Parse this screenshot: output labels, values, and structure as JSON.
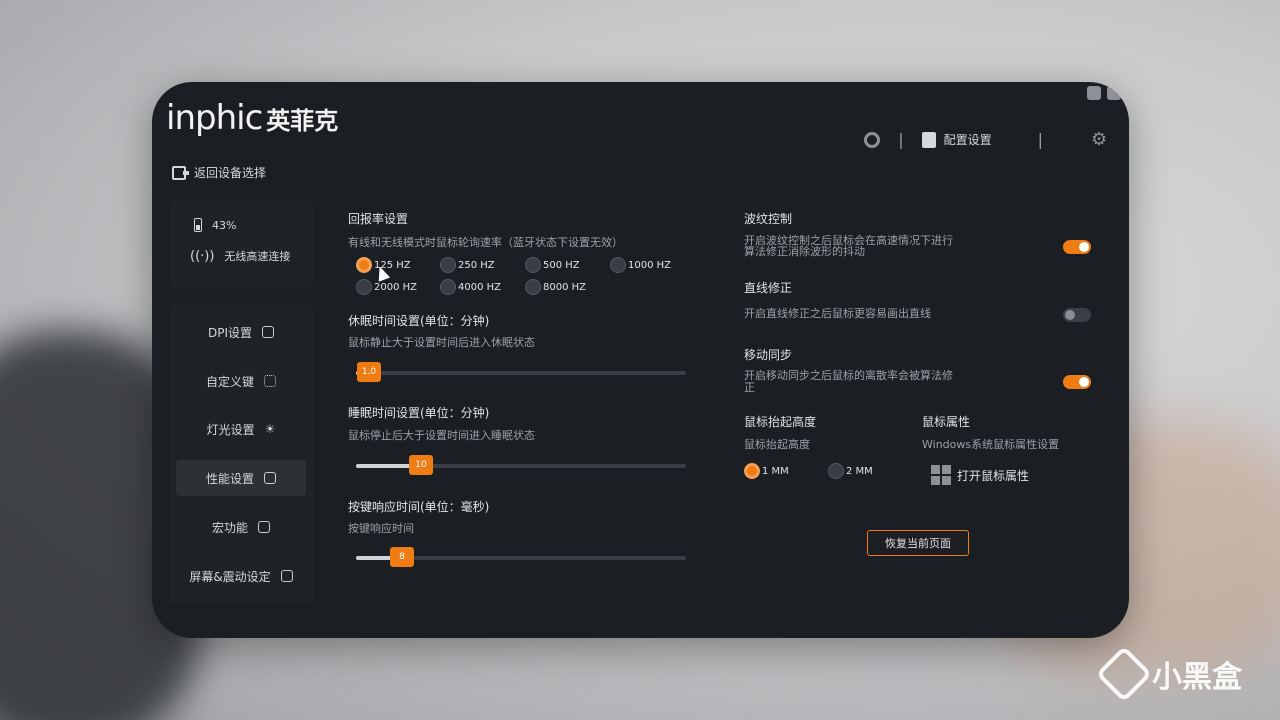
{
  "brand": {
    "name_en": "inphic",
    "name_cn": "英菲克"
  },
  "nav": {
    "back_label": "返回设备选择"
  },
  "topbar": {
    "config_label": "配置设置"
  },
  "device": {
    "battery": "43%",
    "connection": "无线高速连接"
  },
  "menu": {
    "items": [
      {
        "label": "DPI设置",
        "icon": "dpi-icon"
      },
      {
        "label": "自定义键",
        "icon": "keys-icon"
      },
      {
        "label": "灯光设置",
        "icon": "light-icon"
      },
      {
        "label": "性能设置",
        "icon": "performance-icon"
      },
      {
        "label": "宏功能",
        "icon": "macro-icon"
      },
      {
        "label": "屏幕&震动设定",
        "icon": "screen-icon"
      }
    ],
    "active_index": 3
  },
  "polling": {
    "title": "回报率设置",
    "desc": "有线和无线模式时鼠标轮询速率（蓝牙状态下设置无效）",
    "options": [
      "125 HZ",
      "250 HZ",
      "500 HZ",
      "1000 HZ",
      "2000 HZ",
      "4000 HZ",
      "8000 HZ"
    ],
    "selected": "125 HZ"
  },
  "idle": {
    "title": "休眠时间设置(单位：分钟)",
    "desc": "鼠标静止大于设置时间后进入休眠状态",
    "value": "1.0",
    "fraction": 0.02
  },
  "sleep": {
    "title": "睡眠时间设置(单位：分钟)",
    "desc": "鼠标停止后大于设置时间进入睡眠状态",
    "value": "10",
    "fraction": 0.18
  },
  "response": {
    "title": "按键响应时间(单位：毫秒)",
    "desc": "按键响应时间",
    "value": "8",
    "fraction": 0.12
  },
  "ripple": {
    "title": "波纹控制",
    "desc_line1": "开启波纹控制之后鼠标会在高速情况下进行",
    "desc_line2": "算法修正消除波形的抖动",
    "on": true
  },
  "straight": {
    "title": "直线修正",
    "desc": "开启直线修正之后鼠标更容易画出直线",
    "on": false
  },
  "motion_sync": {
    "title": "移动同步",
    "desc_line1": "开启移动同步之后鼠标的离散率会被算法修",
    "desc_line2": "正",
    "on": true
  },
  "lod": {
    "title": "鼠标抬起高度",
    "desc": "鼠标抬起高度",
    "options": [
      "1 MM",
      "2 MM"
    ],
    "selected": "1 MM"
  },
  "props": {
    "title": "鼠标属性",
    "desc": "Windows系统鼠标属性设置",
    "open_label": "打开鼠标属性"
  },
  "reset_label": "恢复当前页面",
  "watermark": "小黑盒",
  "colors": {
    "accent": "#f07d14",
    "panel": "#1b1e22"
  }
}
